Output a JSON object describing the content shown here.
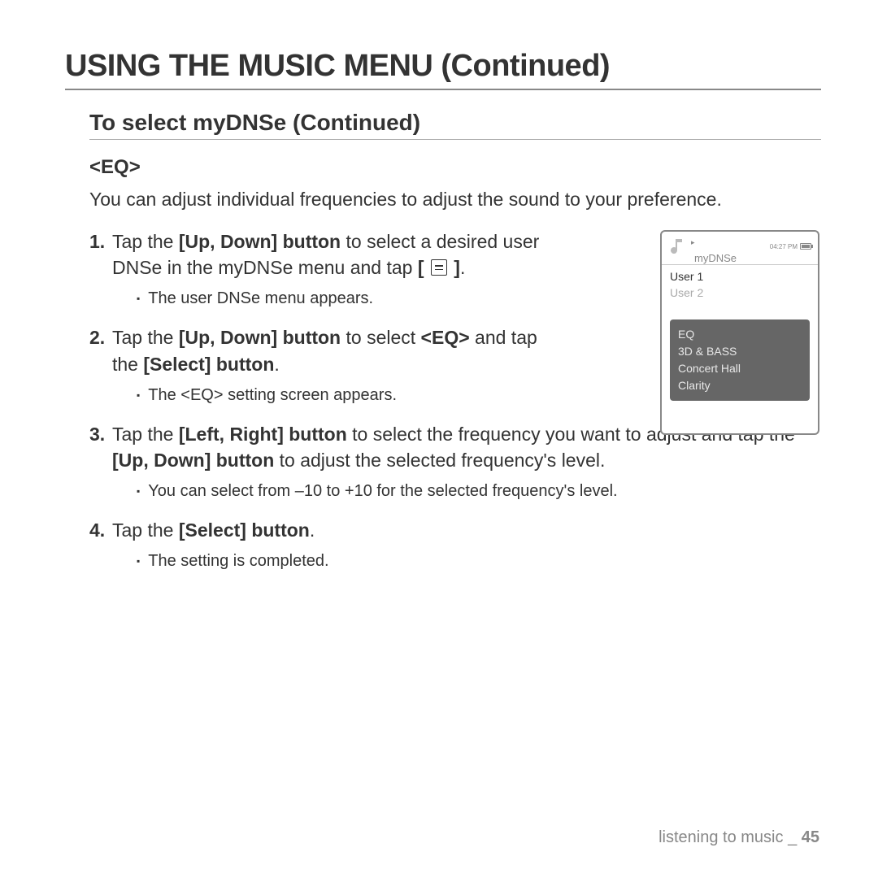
{
  "title": "USING THE MUSIC MENU (Continued)",
  "subtitle": "To select myDNSe (Continued)",
  "sectionLabel": "<EQ>",
  "intro": "You can adjust individual frequencies to adjust the sound to your preference.",
  "steps": [
    {
      "num": "1.",
      "html": "Tap the <b>[Up, Down] button</b> to select a desired user DNSe in the myDNSe menu and tap <b>[ </b><span class='inline-icon' data-name='menu-icon' data-interactable='false'></span><b> ]</b>.",
      "bullet": "The user DNSe menu appears.",
      "narrow": true
    },
    {
      "num": "2.",
      "html": "Tap the <b>[Up, Down] button</b> to select <b>&lt;EQ&gt;</b> and tap the <b>[Select] button</b>.",
      "bullet": "The <EQ> setting screen appears.",
      "narrow": true
    },
    {
      "num": "3.",
      "html": "Tap the <b>[Left, Right] button</b> to select the frequency you want to adjust and tap the <b>[Up, Down] button</b> to adjust the selected frequency's level.",
      "bullet": "You can select from –10 to +10 for the selected frequency's level.",
      "narrow": false
    },
    {
      "num": "4.",
      "html": "Tap the <b>[Select] button</b>.",
      "bullet": "The setting is completed.",
      "narrow": false
    }
  ],
  "device": {
    "time": "04:27 PM",
    "title": "myDNSe",
    "items": [
      "User 1",
      "User 2"
    ],
    "popup": [
      "EQ",
      "3D & BASS",
      "Concert Hall",
      "Clarity"
    ]
  },
  "footer": {
    "section": "listening to music",
    "sep": "_",
    "page": "45"
  }
}
